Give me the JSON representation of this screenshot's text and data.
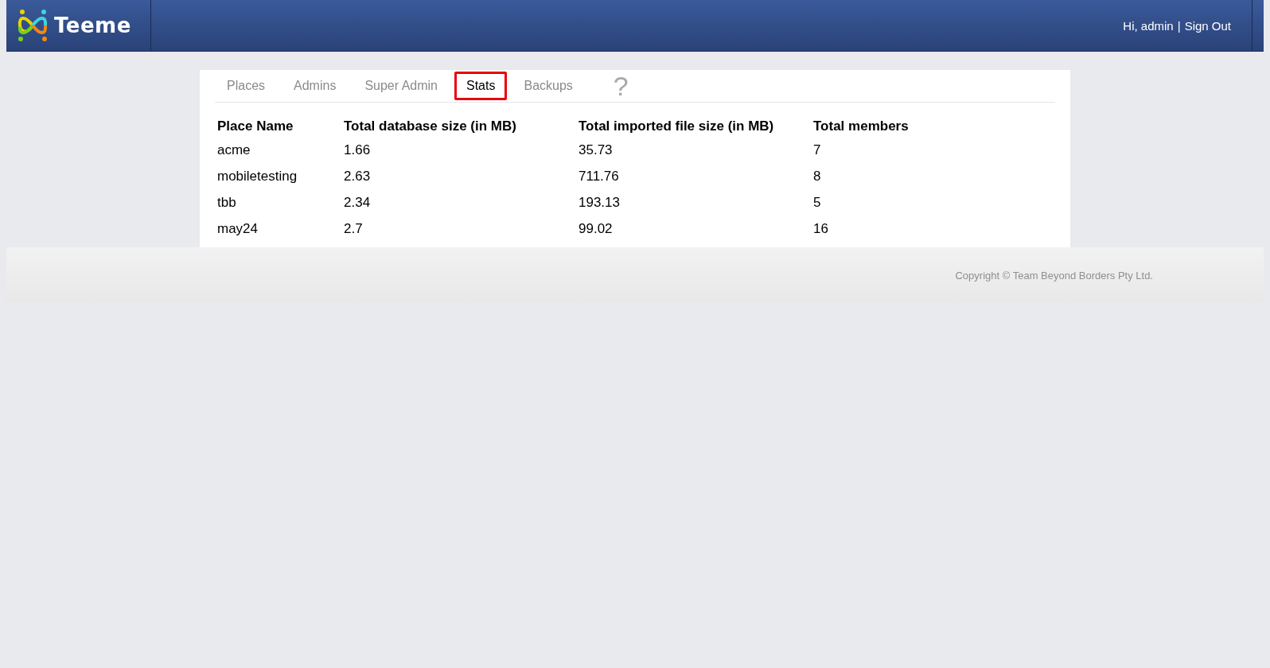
{
  "header": {
    "logo_text": "Teeme",
    "greeting": "Hi, admin",
    "separator": "|",
    "sign_out": "Sign Out"
  },
  "tabs": [
    {
      "label": "Places",
      "selected": false
    },
    {
      "label": "Admins",
      "selected": false
    },
    {
      "label": "Super Admin",
      "selected": false
    },
    {
      "label": "Stats",
      "selected": true
    },
    {
      "label": "Backups",
      "selected": false
    }
  ],
  "help": "?",
  "table": {
    "columns": [
      "Place Name",
      "Total database size (in MB)",
      "Total imported file size (in MB)",
      "Total members"
    ],
    "rows": [
      [
        "acme",
        "1.66",
        "35.73",
        "7"
      ],
      [
        "mobiletesting",
        "2.63",
        "711.76",
        "8"
      ],
      [
        "tbb",
        "2.34",
        "193.13",
        "5"
      ],
      [
        "may24",
        "2.7",
        "99.02",
        "16"
      ]
    ]
  },
  "footer": {
    "copyright": "Copyright © Team Beyond Borders Pty Ltd."
  }
}
